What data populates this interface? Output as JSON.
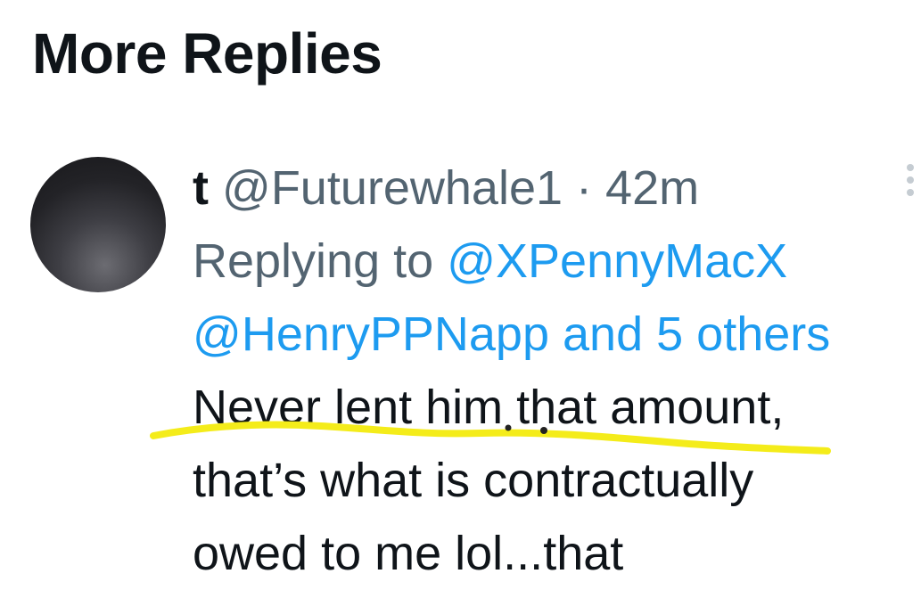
{
  "section": {
    "title": "More Replies"
  },
  "tweet": {
    "author_name": "t",
    "handle": "@Futurewhale1",
    "separator": "·",
    "time": "42m",
    "replying_to_label": "Replying to",
    "replying_to_mention": "@XPennyMacX",
    "also_replying_mention": "@HenryPPNapp",
    "also_replying_connector": "and",
    "also_replying_others": "5 others",
    "text_line_1": "Never lent him that amount,",
    "text_line_2": "that’s what is contractually",
    "text_line_3": "owed to me lol...that"
  },
  "icons": {
    "avatar": "avatar",
    "more_menu": "more-vertical-icon"
  },
  "colors": {
    "text_primary": "#0f1419",
    "text_secondary": "#536471",
    "link": "#1d9bf0",
    "highlight": "#f4ec1a"
  }
}
